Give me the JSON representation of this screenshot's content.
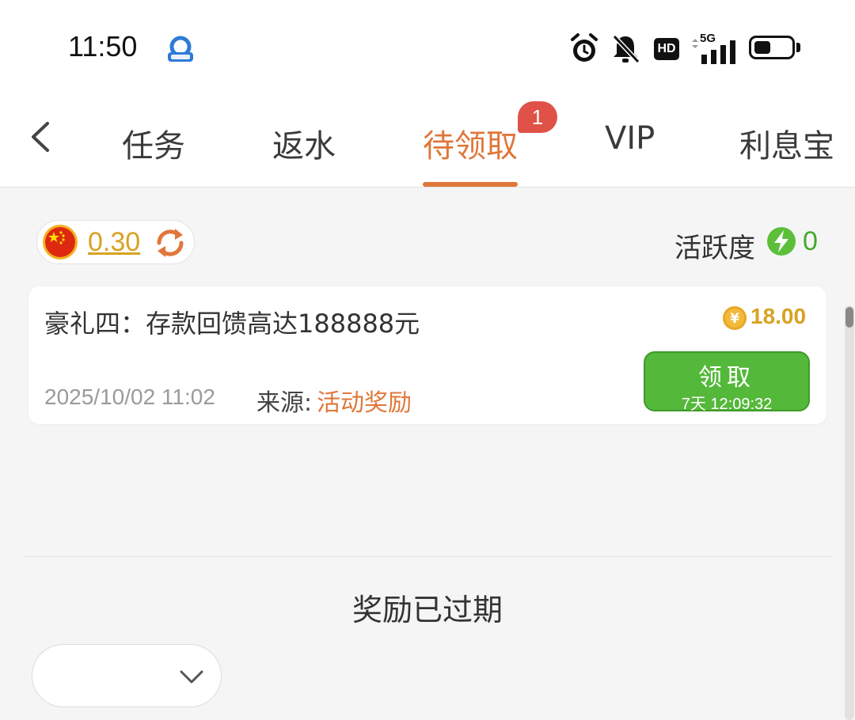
{
  "status_bar": {
    "time": "11:50",
    "network": "5G",
    "hd_label": "HD",
    "battery_level": 0.45,
    "icons": [
      "app-icon",
      "alarm-icon",
      "mute-icon",
      "signal-icon",
      "battery-icon"
    ]
  },
  "nav": {
    "back_icon": "chevron-left-icon",
    "tabs": [
      {
        "label": "任务",
        "active": false
      },
      {
        "label": "返水",
        "active": false
      },
      {
        "label": "待领取",
        "active": true,
        "badge": "1"
      },
      {
        "label": "VIP",
        "active": false
      },
      {
        "label": "利息宝",
        "active": false
      }
    ]
  },
  "balance": {
    "value": "0.30",
    "flag_icon": "china-flag-icon",
    "refresh_icon": "refresh-icon"
  },
  "activity": {
    "label": "活跃度",
    "value": "0",
    "icon": "lightning-icon"
  },
  "reward_card": {
    "title": "豪礼四：存款回馈高达188888元",
    "amount": "18.00",
    "currency_icon": "yuan-coin-icon",
    "date": "2025/10/02 11:02",
    "source_label": "来源:",
    "source_value": "活动奖励",
    "claim_label": "领取",
    "countdown": "7天 12:09:32"
  },
  "expired_section": {
    "title": "奖励已过期",
    "filter_value": ""
  },
  "colors": {
    "accent": "#e0773a",
    "gold": "#d8a223",
    "green": "#54b83a",
    "badge": "#e05248"
  }
}
